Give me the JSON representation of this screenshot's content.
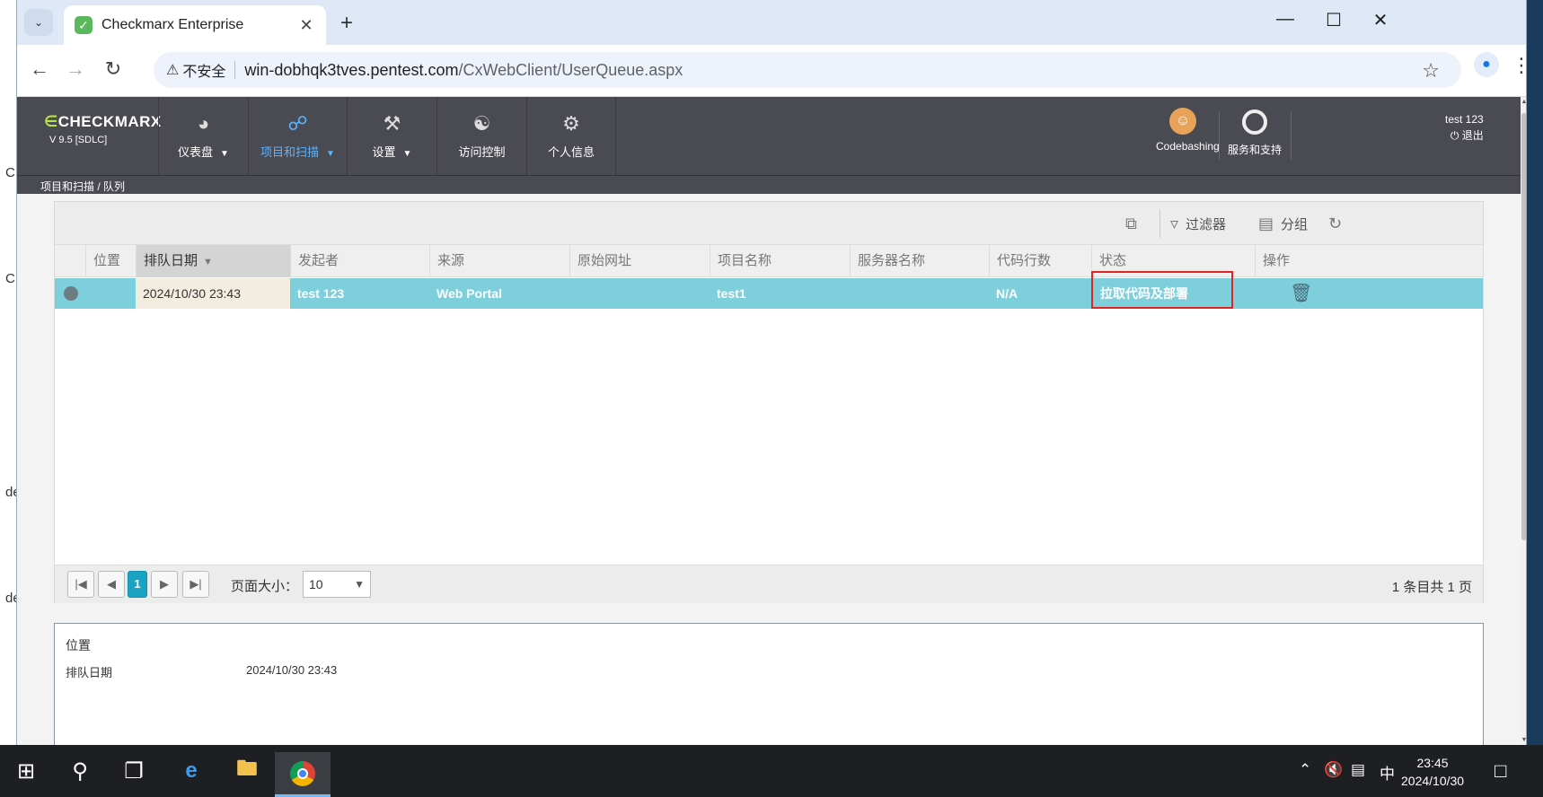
{
  "desktop": {
    "fragments": [
      "C",
      "C",
      "de",
      "de"
    ]
  },
  "browser": {
    "tab_title": "Checkmarx Enterprise",
    "insecure_label": "不安全",
    "url_host": "win-dobhqk3tves.pentest.com",
    "url_path": "/CxWebClient/UserQueue.aspx"
  },
  "app": {
    "logo_text": "CHECKMARX",
    "version": "V 9.5  [SDLC]",
    "nav": [
      {
        "label": "仪表盘",
        "icon": "gauge-icon"
      },
      {
        "label": "项目和扫描",
        "icon": "project-scan-icon",
        "active": true
      },
      {
        "label": "设置",
        "icon": "wrench-icon"
      },
      {
        "label": "访问控制",
        "icon": "users-icon"
      },
      {
        "label": "个人信息",
        "icon": "user-gear-icon"
      }
    ],
    "codebashing": "Codebashing",
    "support": "服务和支持",
    "username": "test 123",
    "logout": "退出",
    "breadcrumb": "项目和扫描 / 队列"
  },
  "toolbar": {
    "filter": "过滤器",
    "group": "分组"
  },
  "table": {
    "columns": [
      "位置",
      "排队日期",
      "发起者",
      "来源",
      "原始网址",
      "项目名称",
      "服务器名称",
      "代码行数",
      "状态",
      "操作"
    ],
    "rows": [
      {
        "position": "",
        "date": "2024/10/30 23:43",
        "initiator": "test 123",
        "source": "Web Portal",
        "origin_url": "",
        "project": "test1",
        "server": "",
        "loc": "N/A",
        "status": "拉取代码及部署"
      }
    ]
  },
  "pager": {
    "current_page": "1",
    "size_label": "页面大小：",
    "page_size": "10",
    "info": "1 条目共 1 页"
  },
  "detail": {
    "position_label": "位置",
    "date_label": "排队日期",
    "date_value": "2024/10/30 23:43"
  },
  "taskbar": {
    "time": "23:45",
    "date": "2024/10/30",
    "ime": "中"
  }
}
